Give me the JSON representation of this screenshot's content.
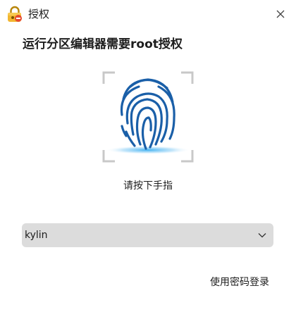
{
  "window": {
    "title": "授权",
    "app_icon": "lock-icon",
    "close_icon": "close-icon"
  },
  "main": {
    "heading": "运行分区编辑器需要root授权",
    "fingerprint_icon": "fingerprint-icon",
    "hint": "请按下手指",
    "user_select": {
      "value": "kylin",
      "icon": "chevron-down-icon"
    },
    "password_login": "使用密码登录"
  },
  "colors": {
    "accent": "#1a5fa8",
    "glow": "#29a8f0",
    "select_bg": "#dcdcdc"
  }
}
